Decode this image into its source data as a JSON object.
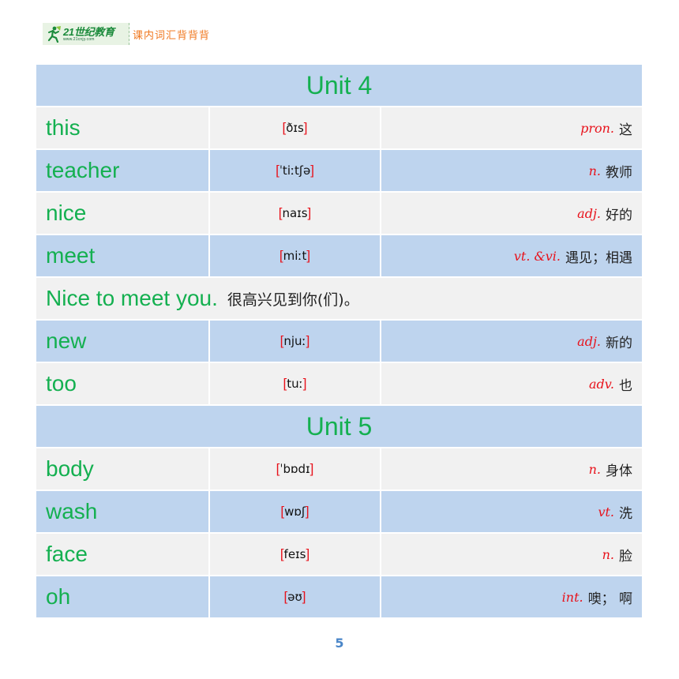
{
  "header": {
    "logo_main": "21世纪教育",
    "logo_sub": "www.21cnjy.com",
    "title": "课内词汇背背背"
  },
  "colors": {
    "word_green": "#14b050",
    "bracket_red": "#e8121b",
    "row_blue": "#bed4ee",
    "row_grey": "#f1f1f1",
    "header_orange": "#f07820",
    "page_number_blue": "#4a86c8"
  },
  "units": [
    {
      "title": "Unit 4",
      "rows": [
        {
          "type": "word",
          "word": "this",
          "phonetic": "ðɪs",
          "pos": "pron.",
          "meaning": "这"
        },
        {
          "type": "word",
          "word": "teacher",
          "phonetic": "ˈtiːtʃə",
          "pos": "n.",
          "meaning": "教师"
        },
        {
          "type": "word",
          "word": "nice",
          "phonetic": "naɪs",
          "pos": "adj.",
          "meaning": "好的"
        },
        {
          "type": "word",
          "word": "meet",
          "phonetic": "miːt",
          "pos": "vt. &vi.",
          "meaning": "遇见；相遇"
        },
        {
          "type": "phrase",
          "english": "Nice to meet you.",
          "chinese": "很高兴见到你(们)。"
        },
        {
          "type": "word",
          "word": "new",
          "phonetic": "njuː",
          "pos": "adj.",
          "meaning": "新的"
        },
        {
          "type": "word",
          "word": "too",
          "phonetic": "tuː",
          "pos": "adv.",
          "meaning": "也"
        }
      ]
    },
    {
      "title": "Unit 5",
      "rows": [
        {
          "type": "word",
          "word": "body",
          "phonetic": "ˈbɒdɪ",
          "pos": "n.",
          "meaning": "身体"
        },
        {
          "type": "word",
          "word": "wash",
          "phonetic": "wɒʃ",
          "pos": "vt.",
          "meaning": "洗"
        },
        {
          "type": "word",
          "word": "face",
          "phonetic": "feɪs",
          "pos": "n.",
          "meaning": "脸"
        },
        {
          "type": "word",
          "word": "oh",
          "phonetic": "əʊ",
          "pos": "int.",
          "meaning": "噢； 啊"
        }
      ]
    }
  ],
  "brackets": {
    "open": "[",
    "close": "]"
  },
  "page_number": "5"
}
